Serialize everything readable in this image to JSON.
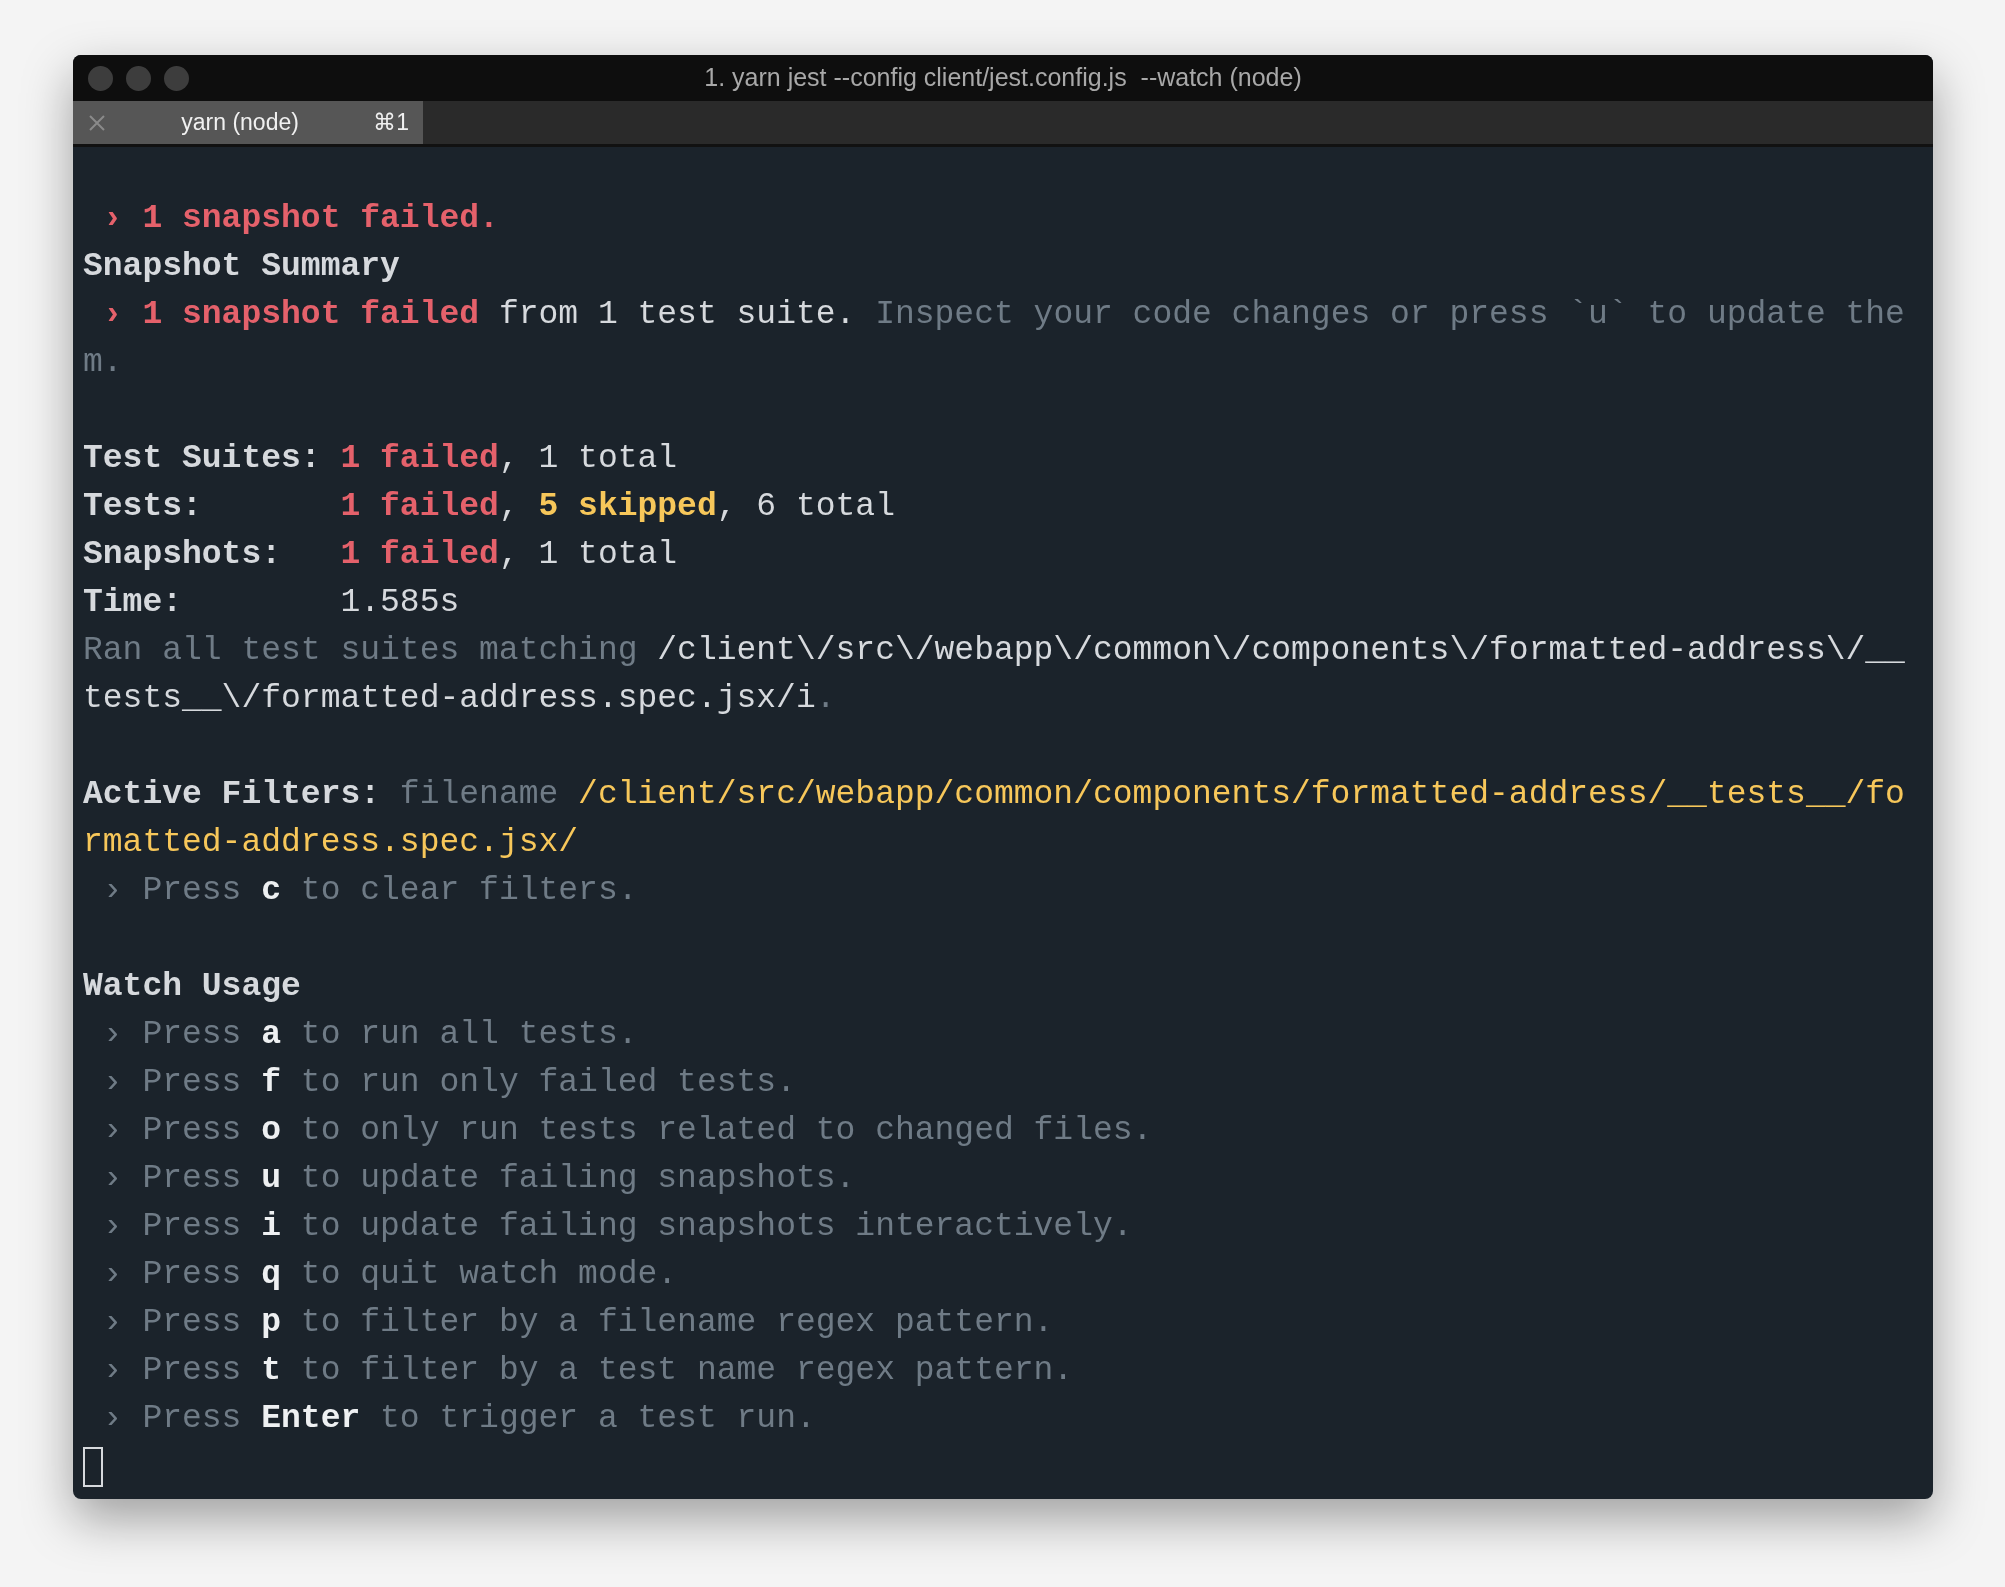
{
  "window": {
    "title": "1. yarn jest --config client/jest.config.js  --watch (node)"
  },
  "tabs": [
    {
      "label": "yarn (node)",
      "shortcut": "⌘1"
    }
  ],
  "terminal": {
    "lines": [
      {
        "kind": "blank"
      },
      {
        "kind": "text",
        "segments": [
          {
            "kind": "error",
            "text": " › 1 snapshot failed."
          }
        ]
      },
      {
        "kind": "text",
        "segments": [
          {
            "kind": "bold",
            "text": "Snapshot Summary"
          }
        ]
      },
      {
        "kind": "text",
        "segments": [
          {
            "kind": "error",
            "text": " › 1 snapshot failed"
          },
          {
            "kind": "plain",
            "text": " from 1 test suite. "
          },
          {
            "kind": "dim",
            "text": "Inspect your code changes or press `u` to update the"
          }
        ]
      },
      {
        "kind": "text",
        "segments": [
          {
            "kind": "dim",
            "text": "m."
          }
        ]
      },
      {
        "kind": "blank"
      },
      {
        "kind": "text",
        "segments": [
          {
            "kind": "bold",
            "text": "Test Suites: "
          },
          {
            "kind": "error",
            "text": "1 failed"
          },
          {
            "kind": "plain",
            "text": ", 1 total"
          }
        ]
      },
      {
        "kind": "text",
        "segments": [
          {
            "kind": "bold",
            "text": "Tests:       "
          },
          {
            "kind": "error",
            "text": "1 failed"
          },
          {
            "kind": "plain",
            "text": ", "
          },
          {
            "kind": "warn",
            "text": "5 skipped"
          },
          {
            "kind": "plain",
            "text": ", 6 total"
          }
        ]
      },
      {
        "kind": "text",
        "segments": [
          {
            "kind": "bold",
            "text": "Snapshots:   "
          },
          {
            "kind": "error",
            "text": "1 failed"
          },
          {
            "kind": "plain",
            "text": ", 1 total"
          }
        ]
      },
      {
        "kind": "text",
        "segments": [
          {
            "kind": "bold",
            "text": "Time:        "
          },
          {
            "kind": "plain",
            "text": "1.585s"
          }
        ]
      },
      {
        "kind": "text",
        "segments": [
          {
            "kind": "dim",
            "text": "Ran all test suites matching "
          },
          {
            "kind": "plain",
            "text": "/client\\/src\\/webapp\\/common\\/components\\/formatted-address\\/__"
          }
        ]
      },
      {
        "kind": "text",
        "segments": [
          {
            "kind": "plain",
            "text": "tests__\\/formatted-address.spec.jsx/i"
          },
          {
            "kind": "dim",
            "text": "."
          }
        ]
      },
      {
        "kind": "blank"
      },
      {
        "kind": "text",
        "segments": [
          {
            "kind": "bold",
            "text": "Active Filters: "
          },
          {
            "kind": "dim",
            "text": "filename "
          },
          {
            "kind": "path",
            "text": "/client/src/webapp/common/components/formatted-address/__tests__/fo"
          }
        ]
      },
      {
        "kind": "text",
        "segments": [
          {
            "kind": "path",
            "text": "rmatted-address.spec.jsx/"
          }
        ]
      },
      {
        "kind": "text",
        "segments": [
          {
            "kind": "dim",
            "text": " › Press "
          },
          {
            "kind": "key",
            "text": "c"
          },
          {
            "kind": "dim",
            "text": " to clear filters."
          }
        ]
      },
      {
        "kind": "blank"
      },
      {
        "kind": "text",
        "segments": [
          {
            "kind": "bold",
            "text": "Watch Usage"
          }
        ]
      },
      {
        "kind": "text",
        "segments": [
          {
            "kind": "dim",
            "text": " › Press "
          },
          {
            "kind": "key",
            "text": "a"
          },
          {
            "kind": "dim",
            "text": " to run all tests."
          }
        ]
      },
      {
        "kind": "text",
        "segments": [
          {
            "kind": "dim",
            "text": " › Press "
          },
          {
            "kind": "key",
            "text": "f"
          },
          {
            "kind": "dim",
            "text": " to run only failed tests."
          }
        ]
      },
      {
        "kind": "text",
        "segments": [
          {
            "kind": "dim",
            "text": " › Press "
          },
          {
            "kind": "key",
            "text": "o"
          },
          {
            "kind": "dim",
            "text": " to only run tests related to changed files."
          }
        ]
      },
      {
        "kind": "text",
        "segments": [
          {
            "kind": "dim",
            "text": " › Press "
          },
          {
            "kind": "key",
            "text": "u"
          },
          {
            "kind": "dim",
            "text": " to update failing snapshots."
          }
        ]
      },
      {
        "kind": "text",
        "segments": [
          {
            "kind": "dim",
            "text": " › Press "
          },
          {
            "kind": "key",
            "text": "i"
          },
          {
            "kind": "dim",
            "text": " to update failing snapshots interactively."
          }
        ]
      },
      {
        "kind": "text",
        "segments": [
          {
            "kind": "dim",
            "text": " › Press "
          },
          {
            "kind": "key",
            "text": "q"
          },
          {
            "kind": "dim",
            "text": " to quit watch mode."
          }
        ]
      },
      {
        "kind": "text",
        "segments": [
          {
            "kind": "dim",
            "text": " › Press "
          },
          {
            "kind": "key",
            "text": "p"
          },
          {
            "kind": "dim",
            "text": " to filter by a filename regex pattern."
          }
        ]
      },
      {
        "kind": "text",
        "segments": [
          {
            "kind": "dim",
            "text": " › Press "
          },
          {
            "kind": "key",
            "text": "t"
          },
          {
            "kind": "dim",
            "text": " to filter by a test name regex pattern."
          }
        ]
      },
      {
        "kind": "text",
        "segments": [
          {
            "kind": "dim",
            "text": " › Press "
          },
          {
            "kind": "key",
            "text": "Enter"
          },
          {
            "kind": "dim",
            "text": " to trigger a test run."
          }
        ]
      },
      {
        "kind": "cursor"
      }
    ]
  }
}
